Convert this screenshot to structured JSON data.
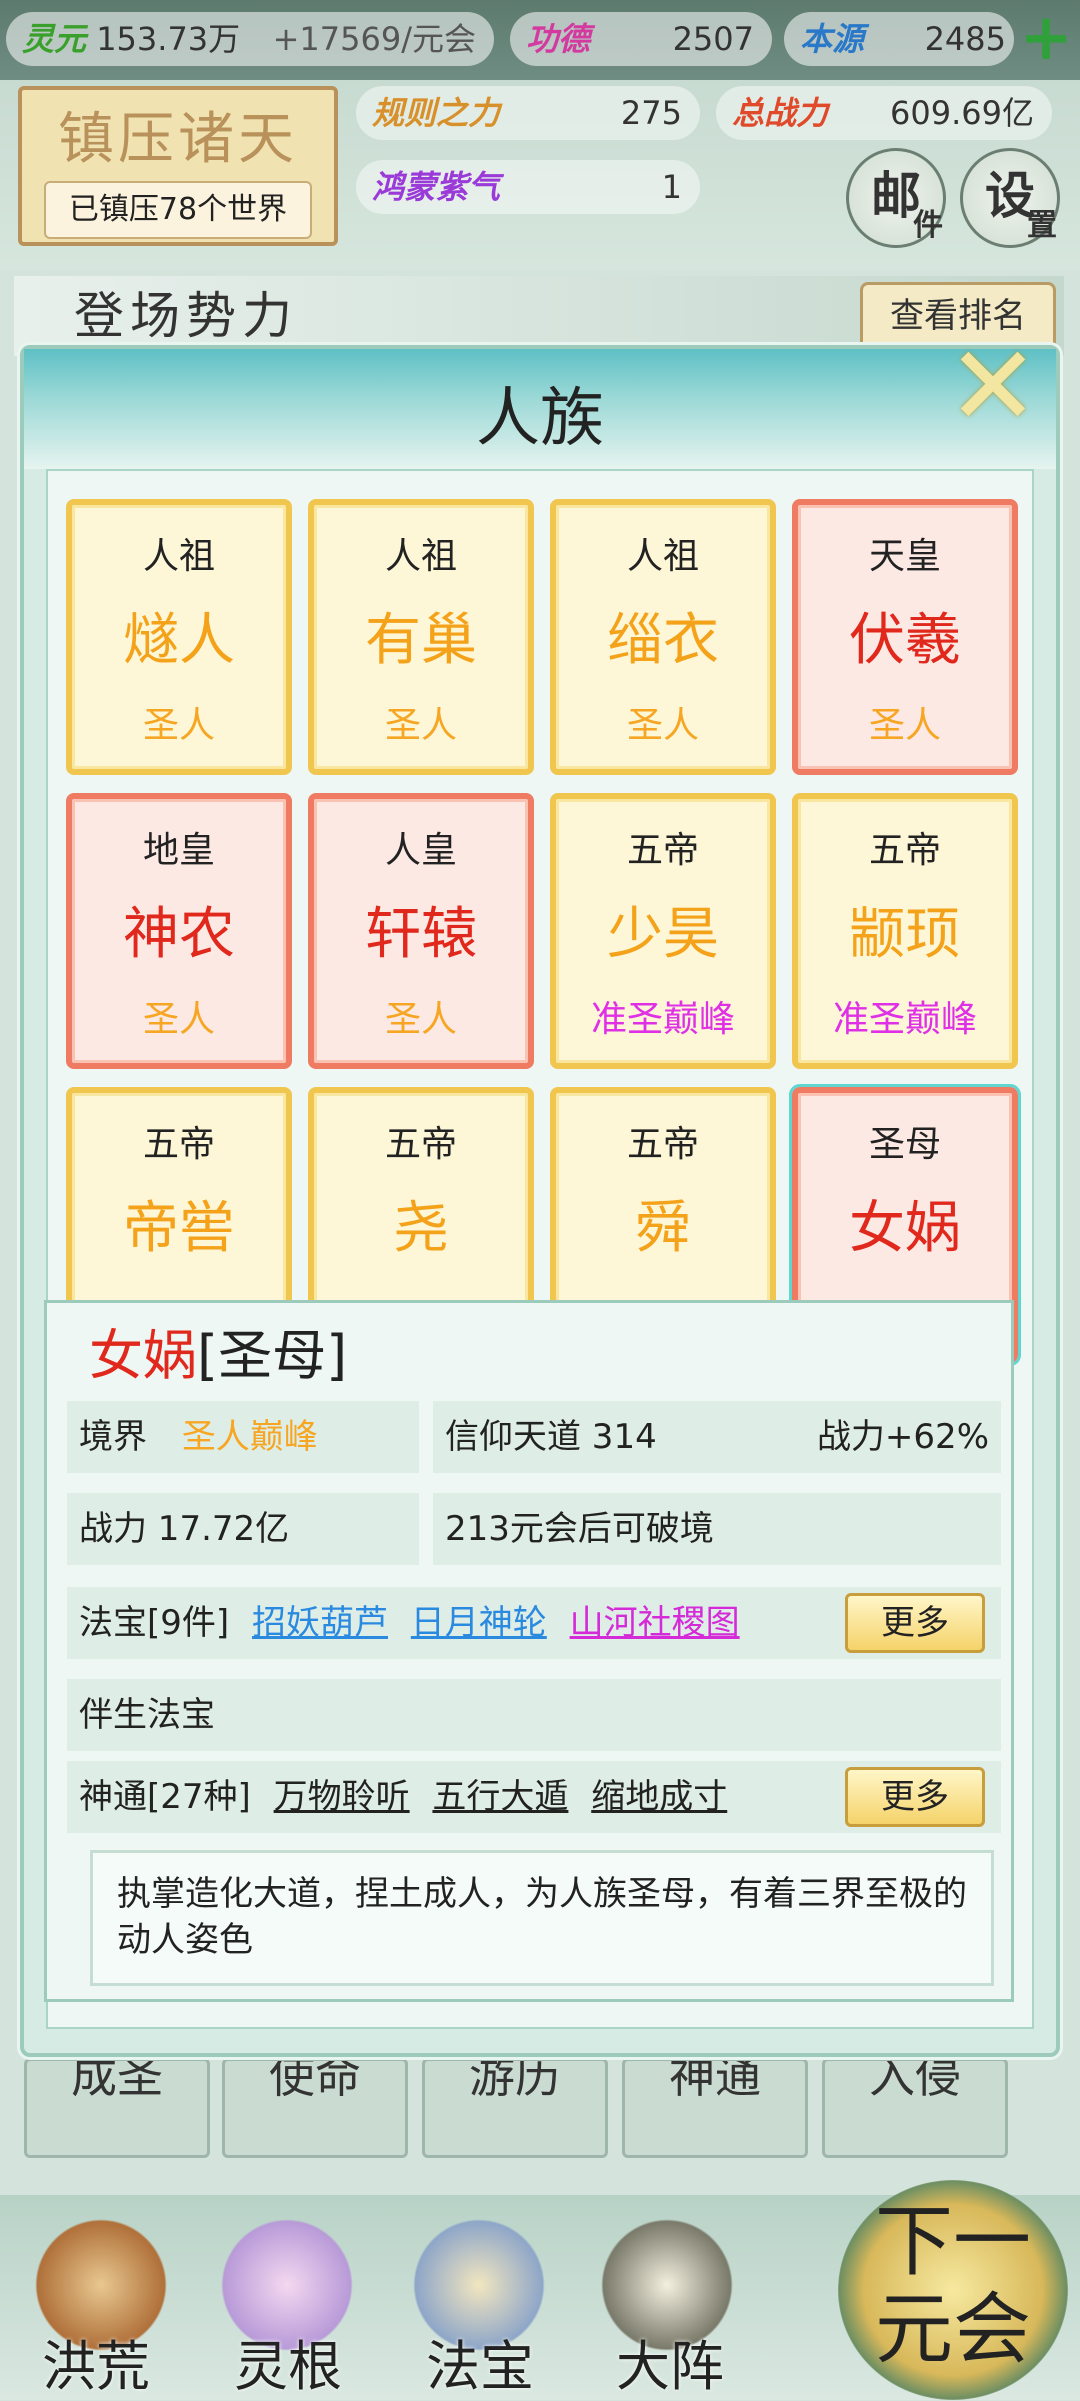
{
  "resources": {
    "lingyuan_label": "灵元",
    "lingyuan_value": "153.73万",
    "lingyuan_rate": "+17569/元会",
    "gongde_label": "功德",
    "gongde_value": "2507",
    "benyuan_label": "本源",
    "benyuan_value": "2485",
    "guize_label": "规则之力",
    "guize_value": "275",
    "zhanli_label": "总战力",
    "zhanli_value": "609.69亿",
    "hongmeng_label": "鸿蒙紫气",
    "hongmeng_value": "1"
  },
  "badge": {
    "title": "镇压诸天",
    "sub": "已镇压78个世界"
  },
  "mail": {
    "main": "邮",
    "sub": "件"
  },
  "settings": {
    "main": "设",
    "sub": "置"
  },
  "section_title": "登场势力",
  "rank_button": "查看排名",
  "dialog": {
    "title": "人族",
    "close": "✕"
  },
  "cards": [
    {
      "rank": "人祖",
      "name": "燧人",
      "level": "圣人"
    },
    {
      "rank": "人祖",
      "name": "有巢",
      "level": "圣人"
    },
    {
      "rank": "人祖",
      "name": "缁衣",
      "level": "圣人"
    },
    {
      "rank": "天皇",
      "name": "伏羲",
      "level": "圣人"
    },
    {
      "rank": "地皇",
      "name": "神农",
      "level": "圣人"
    },
    {
      "rank": "人皇",
      "name": "轩辕",
      "level": "圣人"
    },
    {
      "rank": "五帝",
      "name": "少昊",
      "level": "准圣巅峰"
    },
    {
      "rank": "五帝",
      "name": "颛顼",
      "level": "准圣巅峰"
    },
    {
      "rank": "五帝",
      "name": "帝喾",
      "level": ""
    },
    {
      "rank": "五帝",
      "name": "尧",
      "level": ""
    },
    {
      "rank": "五帝",
      "name": "舜",
      "level": ""
    },
    {
      "rank": "圣母",
      "name": "女娲",
      "level": ""
    }
  ],
  "detail": {
    "name": "女娲",
    "title": "[圣母]",
    "realm_label": "境界",
    "realm_value": "圣人巅峰",
    "faith": "信仰天道 314",
    "faith_bonus": "战力+62%",
    "power": "战力 17.72亿",
    "breakthrough": "213元会后可破境",
    "treasure_label": "法宝[9件]",
    "treasures": [
      "招妖葫芦",
      "日月神轮",
      "山河社稷图"
    ],
    "more": "更多",
    "companion": "伴生法宝",
    "skills_label": "神通[27种]",
    "skills": [
      "万物聆听",
      "五行大遁",
      "缩地成寸"
    ],
    "description": "执掌造化大道，捏土成人，为人族圣母，有着三界至极的动人姿色"
  },
  "behind_tabs": [
    "成圣",
    "使命",
    "游历",
    "神通",
    "入侵"
  ],
  "bottom_nav": [
    "洪荒",
    "灵根",
    "法宝",
    "大阵"
  ],
  "next_era": {
    "line1": "下一",
    "line2": "元会"
  }
}
